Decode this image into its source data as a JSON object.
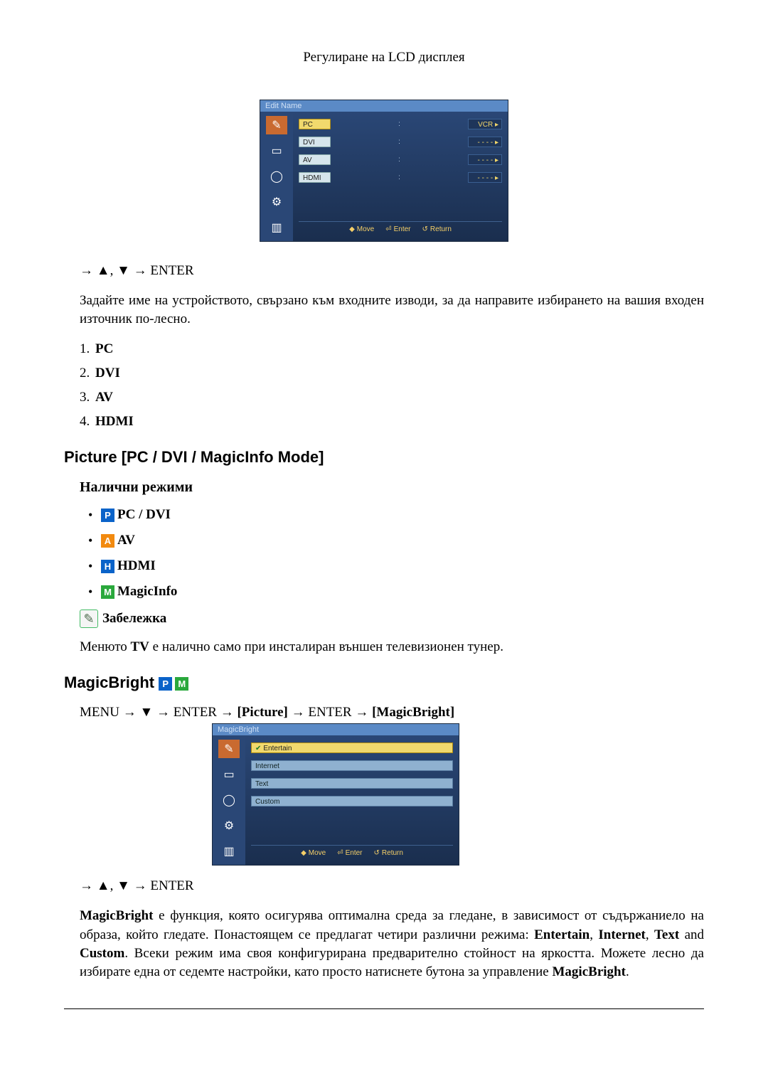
{
  "page_header": "Регулиране на LCD дисплея",
  "osd_edit_name": {
    "title": "Edit Name",
    "rows": [
      {
        "label": "PC",
        "value": "VCR",
        "selected": true
      },
      {
        "label": "DVI",
        "value": "- - - -"
      },
      {
        "label": "AV",
        "value": "- - - -"
      },
      {
        "label": "HDMI",
        "value": "- - - -"
      }
    ],
    "footer": {
      "move": "Move",
      "enter": "Enter",
      "return": "Return"
    }
  },
  "nav_enter_1": {
    "arrow": "→",
    "up": "▲",
    "comma": ",",
    "down": "▼",
    "arrow2": "→",
    "enter": "ENTER"
  },
  "intro_para": "Задайте име на устройството, свързано към входните изводи, за да направите избирането на вашия входен източник по-лесно.",
  "input_list": [
    "PC",
    "DVI",
    "AV",
    "HDMI"
  ],
  "heading_picture": "Picture [PC / DVI / MagicInfo Mode]",
  "heading_modes": "Налични режими",
  "modes": [
    {
      "icon": "P",
      "class": "sq-p",
      "label": "PC / DVI"
    },
    {
      "icon": "A",
      "class": "sq-a",
      "label": "AV"
    },
    {
      "icon": "H",
      "class": "sq-h",
      "label": "HDMI"
    },
    {
      "icon": "M",
      "class": "sq-m",
      "label": "MagicInfo"
    }
  ],
  "note_label": "Забележка",
  "tv_note_pre": "Менюто ",
  "tv_note_b": "TV",
  "tv_note_post": " е налично само при инсталиран външен телевизионен тунер.",
  "heading_magicbright": "MagicBright",
  "mb_nav": {
    "menu": "MENU",
    "arrow": "→",
    "down": "▼",
    "enter": "ENTER",
    "picture": "[Picture]",
    "magicbright": "[MagicBright]"
  },
  "osd_magicbright": {
    "title": "MagicBright",
    "rows": [
      {
        "label": "Entertain",
        "selected": true
      },
      {
        "label": "Internet"
      },
      {
        "label": "Text"
      },
      {
        "label": "Custom"
      }
    ],
    "footer": {
      "move": "Move",
      "enter": "Enter",
      "return": "Return"
    }
  },
  "nav_enter_2": {
    "arrow": "→",
    "up": "▲",
    "comma": ",",
    "down": "▼",
    "arrow2": "→",
    "enter": "ENTER"
  },
  "mb_para": {
    "b1": "MagicBright",
    "t1": " е функция, която осигурява оптимална среда за гледане, в зависимост от съдържаниело на образа, който гледате. Понастоящем се предлагат четири различни режима: ",
    "b2": "Entertain",
    "t2": ", ",
    "b3": "Internet",
    "t3": ", ",
    "b4": "Text",
    "t4": " and ",
    "b5": "Custom",
    "t5": ". Всеки режим има своя конфигурирана предварително стойност на яркостта. Можете лесно да избирате една от седемте настройки, като просто натиснете бутона за управление ",
    "b6": "MagicBright",
    "t6": "."
  }
}
